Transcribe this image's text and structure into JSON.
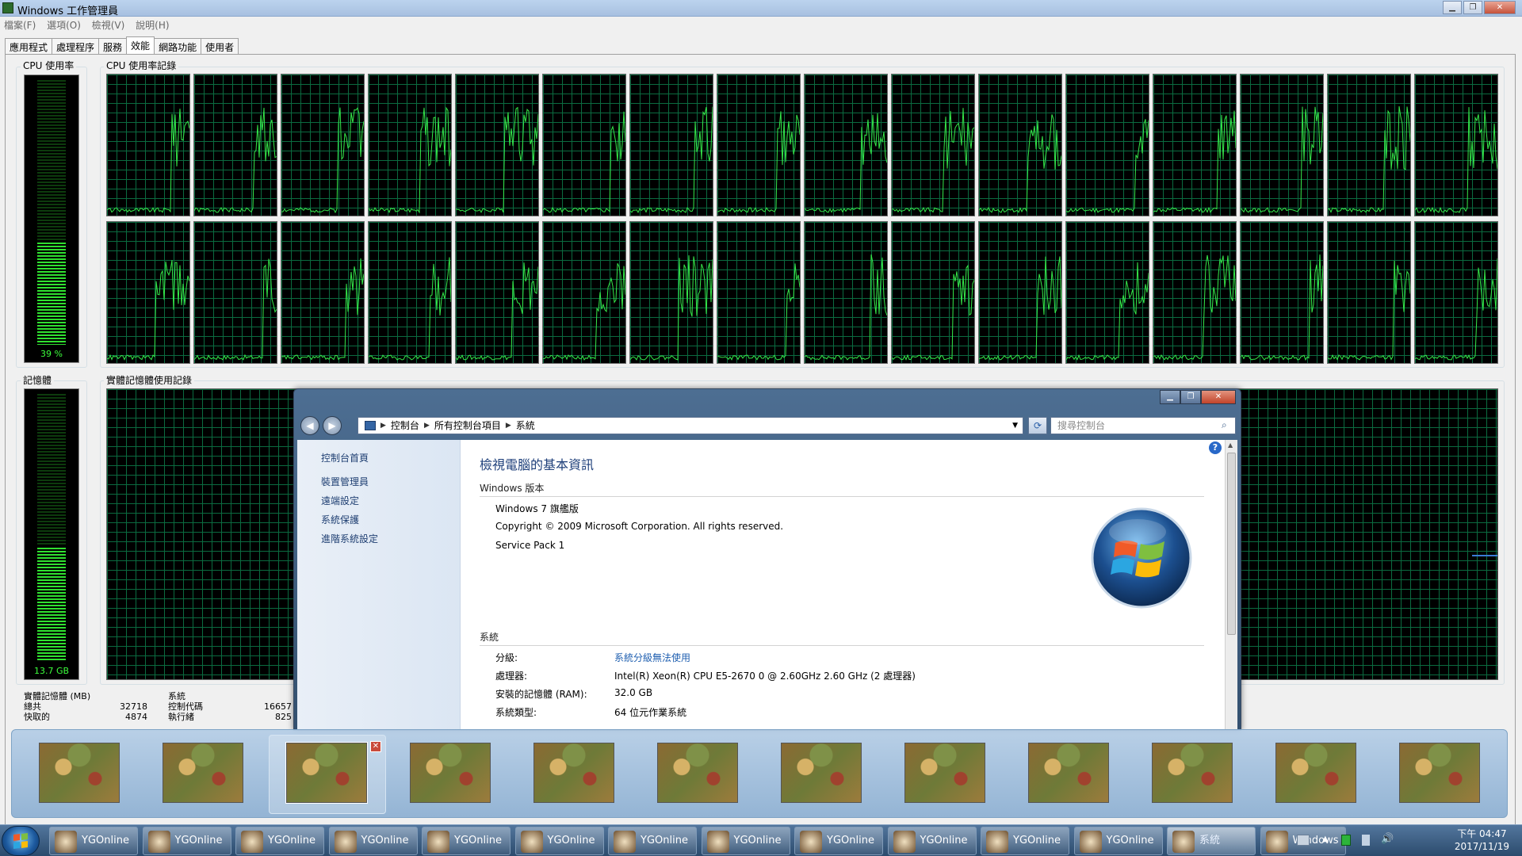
{
  "taskmgr": {
    "title": "Windows 工作管理員",
    "menu": [
      "檔案(F)",
      "選項(O)",
      "檢視(V)",
      "說明(H)"
    ],
    "tabs": [
      "應用程式",
      "處理程序",
      "服務",
      "效能",
      "網路功能",
      "使用者"
    ],
    "active_tab": "效能",
    "cpu_usage_label": "CPU 使用率",
    "cpu_usage_value": "39 %",
    "cpu_usage_fraction": 0.39,
    "cpu_history_label": "CPU 使用率記錄",
    "memory_label": "記憶體",
    "memory_value": "13.7 GB",
    "memory_fraction": 0.43,
    "memory_history_label": "實體記憶體使用記錄",
    "phys_mem": {
      "title": "實體記憶體 (MB)",
      "rows": [
        {
          "label": "總共",
          "value": "32718"
        },
        {
          "label": "快取的",
          "value": "4874"
        }
      ]
    },
    "system_stats": {
      "title": "系統",
      "rows": [
        {
          "label": "控制代碼",
          "value": "16657"
        },
        {
          "label": "執行緒",
          "value": "825"
        }
      ]
    }
  },
  "system_window": {
    "breadcrumb": [
      "控制台",
      "所有控制台項目",
      "系統"
    ],
    "search_placeholder": "搜尋控制台",
    "left_links": [
      "控制台首頁",
      "裝置管理員",
      "遠端設定",
      "系統保護",
      "進階系統設定"
    ],
    "heading": "檢視電腦的基本資訊",
    "windows_edition_title": "Windows 版本",
    "edition": "Windows 7 旗艦版",
    "copyright": "Copyright © 2009 Microsoft Corporation.  All rights reserved.",
    "service_pack": "Service Pack 1",
    "system_title": "系統",
    "rows": [
      {
        "label": "分級:",
        "value": "系統分級無法使用",
        "link": true
      },
      {
        "label": "處理器:",
        "value": "Intel(R) Xeon(R) CPU E5-2670 0 @ 2.60GHz   2.60 GHz  (2 處理器)",
        "link": false
      },
      {
        "label": "安裝的記憶體 (RAM):",
        "value": "32.0 GB",
        "link": false
      },
      {
        "label": "系統類型:",
        "value": "64 位元作業系統",
        "link": false
      }
    ]
  },
  "taskbar": {
    "apps": [
      "YGOnline",
      "YGOnline",
      "YGOnline",
      "YGOnline",
      "YGOnline",
      "YGOnline",
      "YGOnline",
      "YGOnline",
      "YGOnline",
      "YGOnline",
      "YGOnline",
      "YGOnline",
      "系統",
      "Windows ..."
    ],
    "active_index": 12,
    "clock_time": "下午 04:47",
    "clock_date": "2017/11/19"
  },
  "thumbnail_count": 12,
  "selected_thumbnail": 2,
  "colors": {
    "graph_line": "#35e84a",
    "grid": "#0b6b40",
    "meter_fill": "#30e030"
  }
}
